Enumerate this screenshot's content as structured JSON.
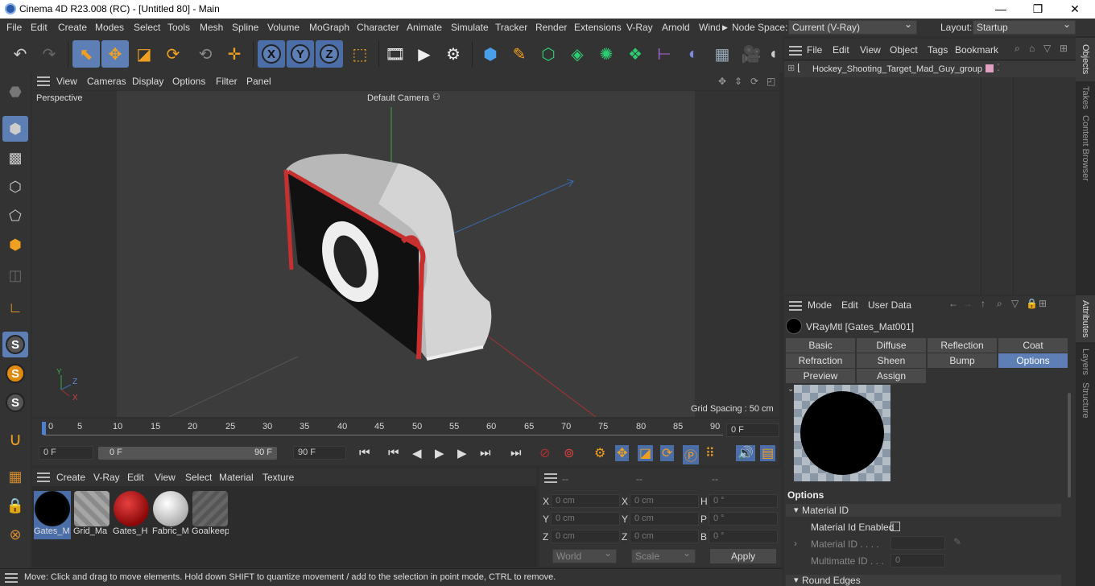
{
  "window": {
    "title": "Cinema 4D R23.008 (RC) - [Untitled 80] - Main",
    "minimize": "—",
    "maximize": "❐",
    "close": "✕"
  },
  "menu": [
    "File",
    "Edit",
    "Create",
    "Modes",
    "Select",
    "Tools",
    "Mesh",
    "Spline",
    "Volume",
    "MoGraph",
    "Character",
    "Animate",
    "Simulate",
    "Tracker",
    "Render",
    "Extensions",
    "V-Ray",
    "Arnold",
    "Wind"
  ],
  "nodespace": {
    "label": "Node Space:",
    "value": "Current (V-Ray)"
  },
  "layout": {
    "label": "Layout:",
    "value": "Startup"
  },
  "viewport": {
    "menu": [
      "View",
      "Cameras",
      "Display",
      "Options",
      "Filter",
      "Panel"
    ],
    "name": "Perspective",
    "camera": "Default Camera",
    "grid": "Grid Spacing : 50 cm",
    "axis": {
      "y": "Y",
      "z": "Z",
      "x": "X"
    }
  },
  "timeline": {
    "ticks": [
      "0",
      "5",
      "10",
      "15",
      "20",
      "25",
      "30",
      "35",
      "40",
      "45",
      "50",
      "55",
      "60",
      "65",
      "70",
      "75",
      "80",
      "85",
      "90"
    ],
    "current": "0 F"
  },
  "transport": {
    "start": "0 F",
    "range_start": "0 F",
    "range_end": "90 F",
    "end": "90 F"
  },
  "materials": {
    "menu": [
      "Create",
      "V-Ray",
      "Edit",
      "View",
      "Select",
      "Material",
      "Texture"
    ],
    "items": [
      {
        "label": "Gates_M",
        "color": "#000000"
      },
      {
        "label": "Grid_Ma",
        "color": "#9a9a9a"
      },
      {
        "label": "Gates_H",
        "color": "#b81010"
      },
      {
        "label": "Fabric_M",
        "color": "#e8e8e8"
      },
      {
        "label": "Goalkeep",
        "color": "#555555"
      }
    ]
  },
  "coords": {
    "headers": [
      "--",
      "--",
      "--"
    ],
    "rows": [
      {
        "a": "X",
        "av": "0 cm",
        "b": "X",
        "bv": "0 cm",
        "c": "H",
        "cv": "0 °"
      },
      {
        "a": "Y",
        "av": "0 cm",
        "b": "Y",
        "bv": "0 cm",
        "c": "P",
        "cv": "0 °"
      },
      {
        "a": "Z",
        "av": "0 cm",
        "b": "Z",
        "bv": "0 cm",
        "c": "B",
        "cv": "0 °"
      }
    ],
    "world": "World",
    "scale": "Scale",
    "apply": "Apply"
  },
  "status": "Move: Click and drag to move elements. Hold down SHIFT to quantize movement / add to the selection in point mode, CTRL to remove.",
  "objects": {
    "menu": [
      "File",
      "Edit",
      "View",
      "Object",
      "Tags",
      "Bookmarks"
    ],
    "items": [
      {
        "name": "Hockey_Shooting_Target_Mad_Guy_group"
      }
    ]
  },
  "attributes": {
    "menu": [
      "Mode",
      "Edit",
      "User Data"
    ],
    "material": "VRayMtl [Gates_Mat001]",
    "tabs_row1": [
      "Basic",
      "Diffuse",
      "Reflection",
      "Coat"
    ],
    "tabs_row2": [
      "Refraction",
      "Sheen",
      "Bump",
      "Options"
    ],
    "tabs_row3": [
      "Preview Settings",
      "Assign"
    ],
    "section": "Options",
    "group": "Material ID",
    "fields": {
      "enabled": "Material Id Enabled",
      "id": "Material ID . . . .",
      "multimatte": "Multimatte ID . . .",
      "multimatte_value": "0"
    },
    "group2": "Round Edges"
  },
  "side_tabs": [
    "Objects",
    "Takes",
    "Content Browser",
    "Attributes",
    "Layers",
    "Structure"
  ]
}
